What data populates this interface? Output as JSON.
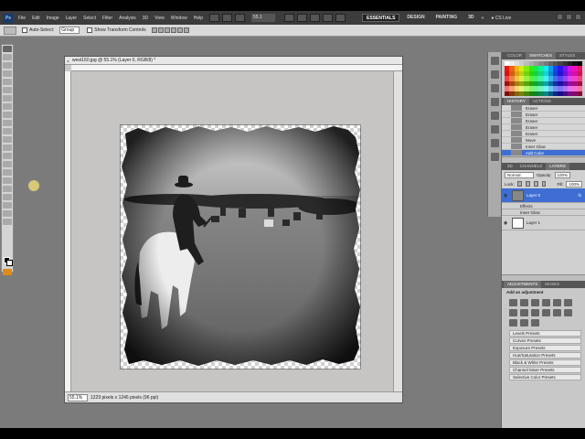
{
  "app": {
    "badge": "Ps"
  },
  "menu": {
    "items": [
      "File",
      "Edit",
      "Image",
      "Layer",
      "Select",
      "Filter",
      "Analysis",
      "3D",
      "View",
      "Window",
      "Help"
    ],
    "zoom": "55.1"
  },
  "workspaces": [
    "ESSENTIALS",
    "DESIGN",
    "PAINTING",
    "3D"
  ],
  "cs_live": "CS Live",
  "options": {
    "auto_select": "Auto-Select:",
    "auto_select_value": "Group",
    "show_transform": "Show Transform Controls"
  },
  "document": {
    "tab_title": "west160.jpg @ 55.1% (Layer 0, RGB/8) *",
    "status_zoom": "55.1%",
    "status_info": "1229 pixels x 1246 pixels (96 ppi)"
  },
  "panels": {
    "swatches_tabs": [
      "COLOR",
      "SWATCHES",
      "STYLES"
    ],
    "history_tabs": [
      "HISTORY",
      "ACTIONS"
    ],
    "history_rows": [
      "Eraser",
      "Eraser",
      "Eraser",
      "Eraser",
      "Eraser",
      "Move",
      "Inner Glow",
      "Add Color"
    ],
    "layers_tabs": [
      "3D",
      "CHANNELS",
      "LAYERS"
    ],
    "blend_mode": "Normal",
    "opacity_label": "Opacity:",
    "opacity": "100%",
    "lock_label": "Lock:",
    "fill_label": "Fill:",
    "fill": "100%",
    "layers": [
      {
        "name": "Layer 0",
        "selected": true
      },
      {
        "name": "Effects",
        "selected": false
      },
      {
        "name": "Inner Glow",
        "selected": false
      },
      {
        "name": "Layer 1",
        "selected": false
      }
    ],
    "adjust_tabs": [
      "ADJUSTMENTS",
      "MASKS"
    ],
    "adjust_title": "Add an adjustment",
    "presets": [
      "Levels Presets",
      "Curves Presets",
      "Exposure Presets",
      "Hue/Saturation Presets",
      "Black & White Presets",
      "Channel Mixer Presets",
      "Selective Color Presets"
    ]
  },
  "colors": {
    "accent": "#3e6ed2",
    "workspace_bg": "#7b7b7b",
    "canvas_bg": "#c6c5c3"
  }
}
